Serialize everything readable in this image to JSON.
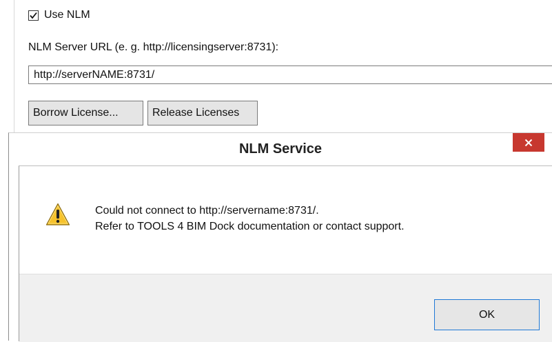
{
  "settings": {
    "use_nlm_label": "Use NLM",
    "use_nlm_checked": true,
    "url_label": "NLM Server URL (e. g. http://licensingserver:8731):",
    "url_value": "http://serverNAME:8731/",
    "borrow_label": "Borrow License...",
    "release_label": "Release Licenses"
  },
  "dialog": {
    "title": "NLM Service",
    "message_line1": "Could not connect to http://servername:8731/.",
    "message_line2": "Refer to TOOLS 4 BIM Dock documentation or contact support.",
    "ok_label": "OK",
    "icon": "warning-icon",
    "close_icon": "close-icon"
  },
  "colors": {
    "close_button": "#c7382f",
    "ok_border": "#1e78d6",
    "warning_fill": "#f6c22c"
  }
}
